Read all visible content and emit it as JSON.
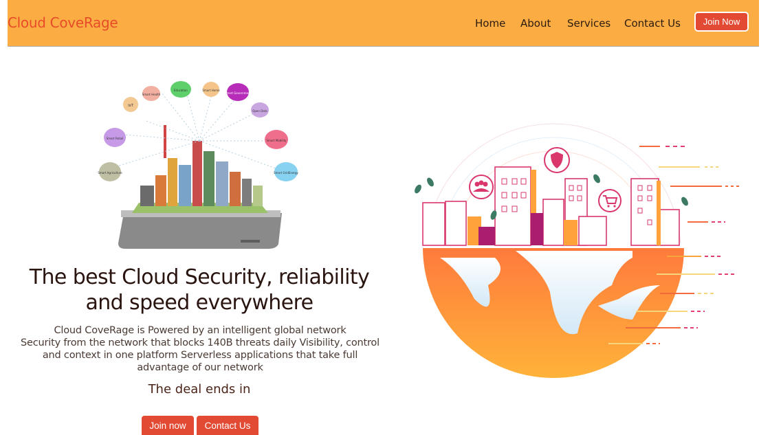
{
  "navbar": {
    "brand": "Cloud CoveRage",
    "links": [
      "Home",
      "About",
      "Services",
      "Contact Us"
    ],
    "join_label": "Join Now"
  },
  "hero": {
    "title_line1": "The best Cloud Security, reliability",
    "title_line2": "and speed everywhere",
    "text_lines": [
      "Cloud CoveRage is Powered by an intelligent global network",
      "Security from the network that blocks 140B threats daily Visibility, control",
      "and context in one platform Serverless applications that take full",
      "advantage of our network"
    ],
    "deal": "The deal ends in",
    "join_label": "Join now",
    "contact_label": "Contact Us"
  },
  "illustration": {
    "bubbles": [
      "IoT",
      "Smart Health",
      "Education",
      "Smart Home",
      "Smart Government",
      "Open Data",
      "Smart Retail",
      "Smart Mobility",
      "Smart Agriculture",
      "Smart GridEnergy"
    ]
  },
  "colors": {
    "nav_bg": "#fbad44",
    "accent": "#e24a33",
    "brand": "#e84b28"
  }
}
